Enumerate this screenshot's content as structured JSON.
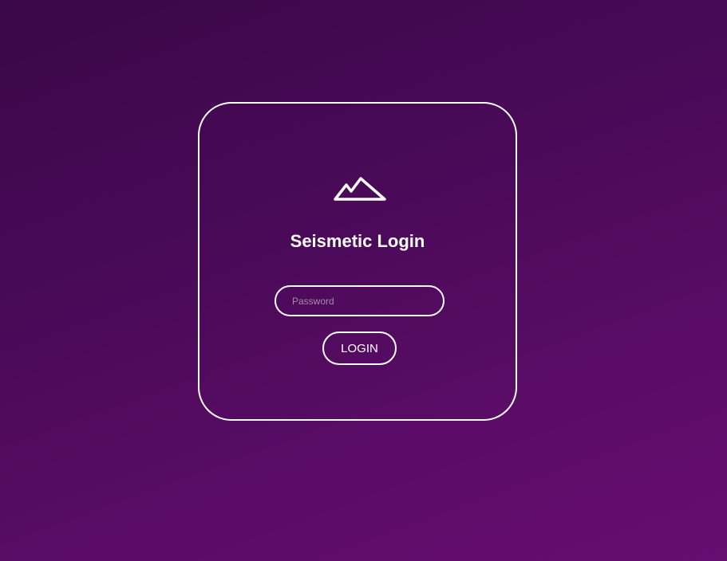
{
  "login": {
    "title": "Seismetic Login",
    "logo_icon": "mountain-icon",
    "password_placeholder": "Password",
    "password_value": "",
    "login_label": "LOGIN"
  },
  "colors": {
    "background_start": "#3a0748",
    "background_end": "#660d70",
    "foreground": "#ffffff",
    "placeholder": "#a58aa8"
  }
}
